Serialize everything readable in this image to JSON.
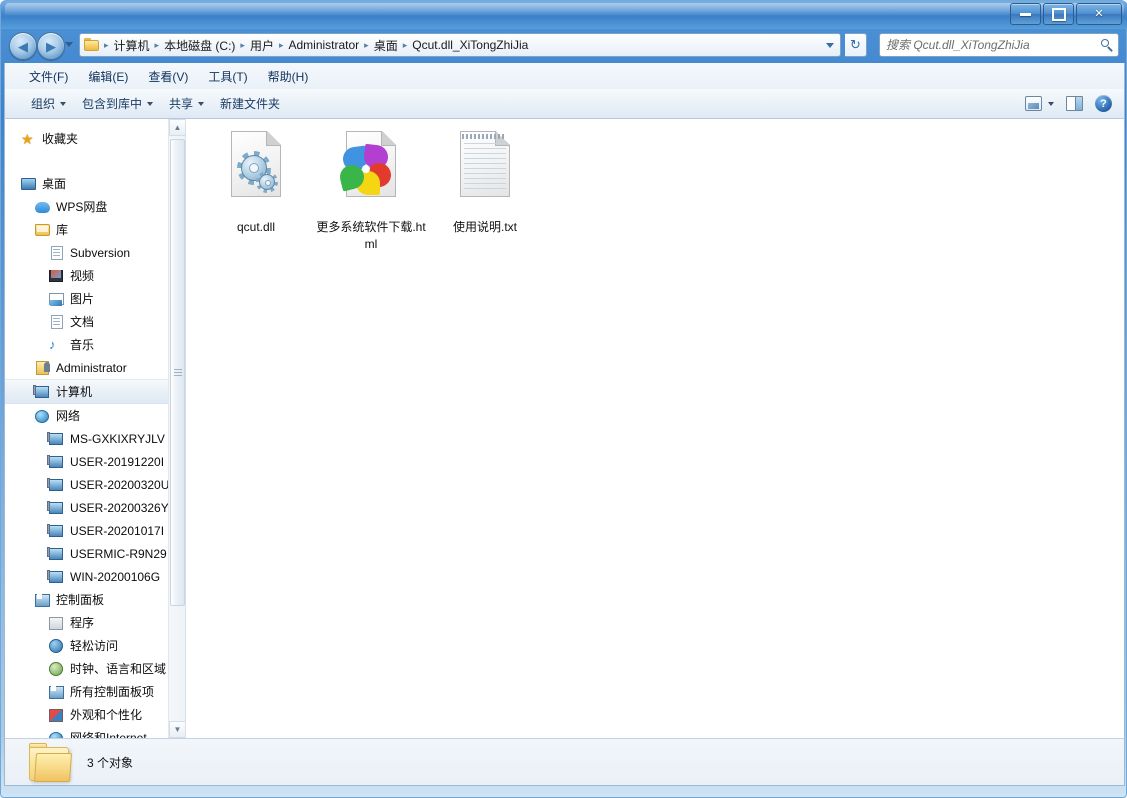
{
  "window": {
    "title": "",
    "buttons": {
      "minimize": "—",
      "maximize": "□",
      "close": "✕"
    }
  },
  "address_bar": {
    "back_tooltip": "后退",
    "forward_tooltip": "前进",
    "breadcrumbs": [
      "计算机",
      "本地磁盘 (C:)",
      "用户",
      "Administrator",
      "桌面",
      "Qcut.dll_XiTongZhiJia"
    ],
    "separator": "▸",
    "dropdown": "▾",
    "refresh": "↻"
  },
  "search": {
    "placeholder": "搜索 Qcut.dll_XiTongZhiJia",
    "value": ""
  },
  "menubar": {
    "items": [
      "文件(F)",
      "编辑(E)",
      "查看(V)",
      "工具(T)",
      "帮助(H)"
    ]
  },
  "toolbar": {
    "items": [
      {
        "label": "组织",
        "has_caret": true
      },
      {
        "label": "包含到库中",
        "has_caret": true
      },
      {
        "label": "共享",
        "has_caret": true
      },
      {
        "label": "新建文件夹",
        "has_caret": false
      }
    ],
    "right_icons": [
      "view-mode-icon",
      "view-mode-caret",
      "preview-pane-icon",
      "help-icon"
    ],
    "help_glyph": "?"
  },
  "sidebar": {
    "items": [
      {
        "label": "收藏夹",
        "icon": "star-icon",
        "indent": 0,
        "selected": false,
        "gap_after": true
      },
      {
        "label": "桌面",
        "icon": "desktop-icon",
        "indent": 0,
        "selected": false
      },
      {
        "label": "WPS网盘",
        "icon": "cloud-icon",
        "indent": 1,
        "selected": false
      },
      {
        "label": "库",
        "icon": "library-icon",
        "indent": 1,
        "selected": false
      },
      {
        "label": "Subversion",
        "icon": "subversion-icon",
        "indent": 2,
        "selected": false
      },
      {
        "label": "视频",
        "icon": "video-icon",
        "indent": 2,
        "selected": false
      },
      {
        "label": "图片",
        "icon": "pictures-icon",
        "indent": 2,
        "selected": false
      },
      {
        "label": "文档",
        "icon": "documents-icon",
        "indent": 2,
        "selected": false
      },
      {
        "label": "音乐",
        "icon": "music-icon",
        "indent": 2,
        "selected": false
      },
      {
        "label": "Administrator",
        "icon": "user-icon",
        "indent": 1,
        "selected": false
      },
      {
        "label": "计算机",
        "icon": "computer-icon",
        "indent": 1,
        "selected": true
      },
      {
        "label": "网络",
        "icon": "network-icon",
        "indent": 1,
        "selected": false
      },
      {
        "label": "MS-GXKIXRYJLV",
        "icon": "computer-icon",
        "indent": 2,
        "selected": false
      },
      {
        "label": "USER-20191220I",
        "icon": "computer-icon",
        "indent": 2,
        "selected": false
      },
      {
        "label": "USER-20200320U",
        "icon": "computer-icon",
        "indent": 2,
        "selected": false
      },
      {
        "label": "USER-20200326Y",
        "icon": "computer-icon",
        "indent": 2,
        "selected": false
      },
      {
        "label": "USER-20201017I",
        "icon": "computer-icon",
        "indent": 2,
        "selected": false
      },
      {
        "label": "USERMIC-R9N29",
        "icon": "computer-icon",
        "indent": 2,
        "selected": false
      },
      {
        "label": "WIN-20200106G",
        "icon": "computer-icon",
        "indent": 2,
        "selected": false
      },
      {
        "label": "控制面板",
        "icon": "control-panel-icon",
        "indent": 1,
        "selected": false
      },
      {
        "label": "程序",
        "icon": "programs-icon",
        "indent": 2,
        "selected": false
      },
      {
        "label": "轻松访问",
        "icon": "ease-of-access-icon",
        "indent": 2,
        "selected": false
      },
      {
        "label": "时钟、语言和区域",
        "icon": "clock-language-icon",
        "indent": 2,
        "selected": false
      },
      {
        "label": "所有控制面板项",
        "icon": "all-control-panel-icon",
        "indent": 2,
        "selected": false
      },
      {
        "label": "外观和个性化",
        "icon": "appearance-icon",
        "indent": 2,
        "selected": false
      },
      {
        "label": "网络和Internet",
        "icon": "network-internet-icon",
        "indent": 2,
        "selected": false
      }
    ],
    "scrollbar": {
      "up": "▲",
      "down": "▼"
    }
  },
  "files": [
    {
      "name": "qcut.dll",
      "icon": "dll-gears-icon"
    },
    {
      "name": "更多系统软件下载.html",
      "icon": "html-pinwheel-icon"
    },
    {
      "name": "使用说明.txt",
      "icon": "text-file-icon"
    }
  ],
  "status": {
    "text": "3 个对象",
    "icon": "folder-icon"
  },
  "colors": {
    "titlebar": "#3d81c9",
    "accent": "#2f6fb5",
    "content_bg": "#ffffff",
    "toolbar_bg": "#eaf1f8"
  }
}
